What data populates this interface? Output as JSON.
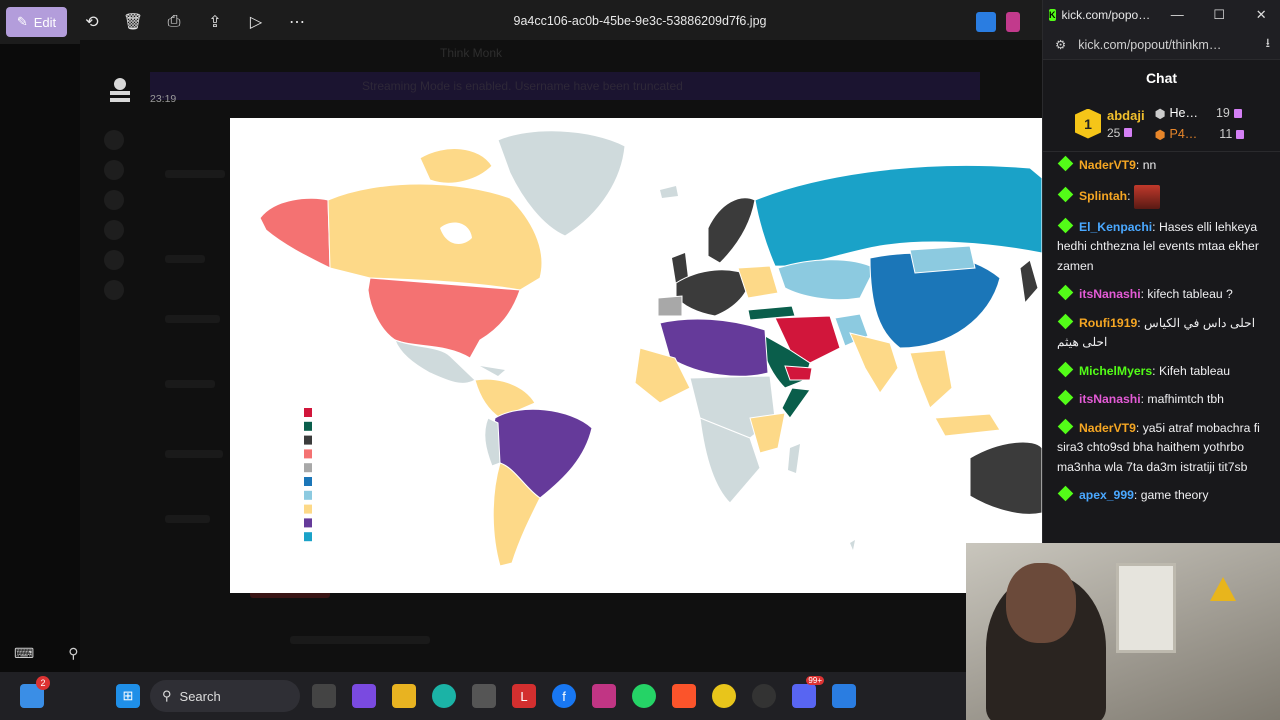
{
  "photos": {
    "edit_label": "Edit",
    "filename": "9a4cc106-ac0b-45be-9e3c-53886209d7f6.jpg"
  },
  "stream": {
    "title": "Think Monk",
    "warning": "Streaming Mode is enabled. Username have been truncated",
    "timer": "23:19"
  },
  "legend": {
    "colors": [
      "#d1163b",
      "#0a5e4b",
      "#3b3b3b",
      "#f47272",
      "#a8a8a8",
      "#1b76b8",
      "#8ccae0",
      "#fdd988",
      "#653a9a",
      "#1aa2c8"
    ]
  },
  "chat_window": {
    "window_title": "kick.com/popo…",
    "url": "kick.com/popout/thinkm…",
    "header": "Chat"
  },
  "leaderboard": {
    "rank": "1",
    "top_name": "abdaji",
    "top_count": "25",
    "second_name": "He…",
    "second_count": "19",
    "third_name": "P4…",
    "third_count": "11"
  },
  "messages": [
    {
      "user": "NaderVT9",
      "color": "#f5a623",
      "text": "nn"
    },
    {
      "user": "Splintah",
      "color": "#f5a623",
      "text": ""
    },
    {
      "user": "El_Kenpachi",
      "color": "#4aa8ff",
      "text": "Hases elli lehkeya hedhi chthezna lel events mtaa ekher zamen"
    },
    {
      "user": "itsNanashi",
      "color": "#e35bd6",
      "text": "kifech tableau ?"
    },
    {
      "user": "Roufi1919",
      "color": "#f5a623",
      "text": "احلى داس في الكياس احلى هيثم"
    },
    {
      "user": "MichelMyers",
      "color": "#53fc18",
      "text": "Kifeh tableau"
    },
    {
      "user": "itsNanashi",
      "color": "#e35bd6",
      "text": "mafhimtch tbh"
    },
    {
      "user": "NaderVT9",
      "color": "#f5a623",
      "text": "ya5i atraf mobachra fi sira3 chto9sd bha haithem yothrbo ma3nha wla 7ta da3m istratiji tit7sb"
    },
    {
      "user": "apex_999",
      "color": "#4aa8ff",
      "text": "game theory"
    }
  ],
  "taskbar": {
    "search_label": "Search",
    "notif_count": "2",
    "discord_badge": "99+"
  }
}
